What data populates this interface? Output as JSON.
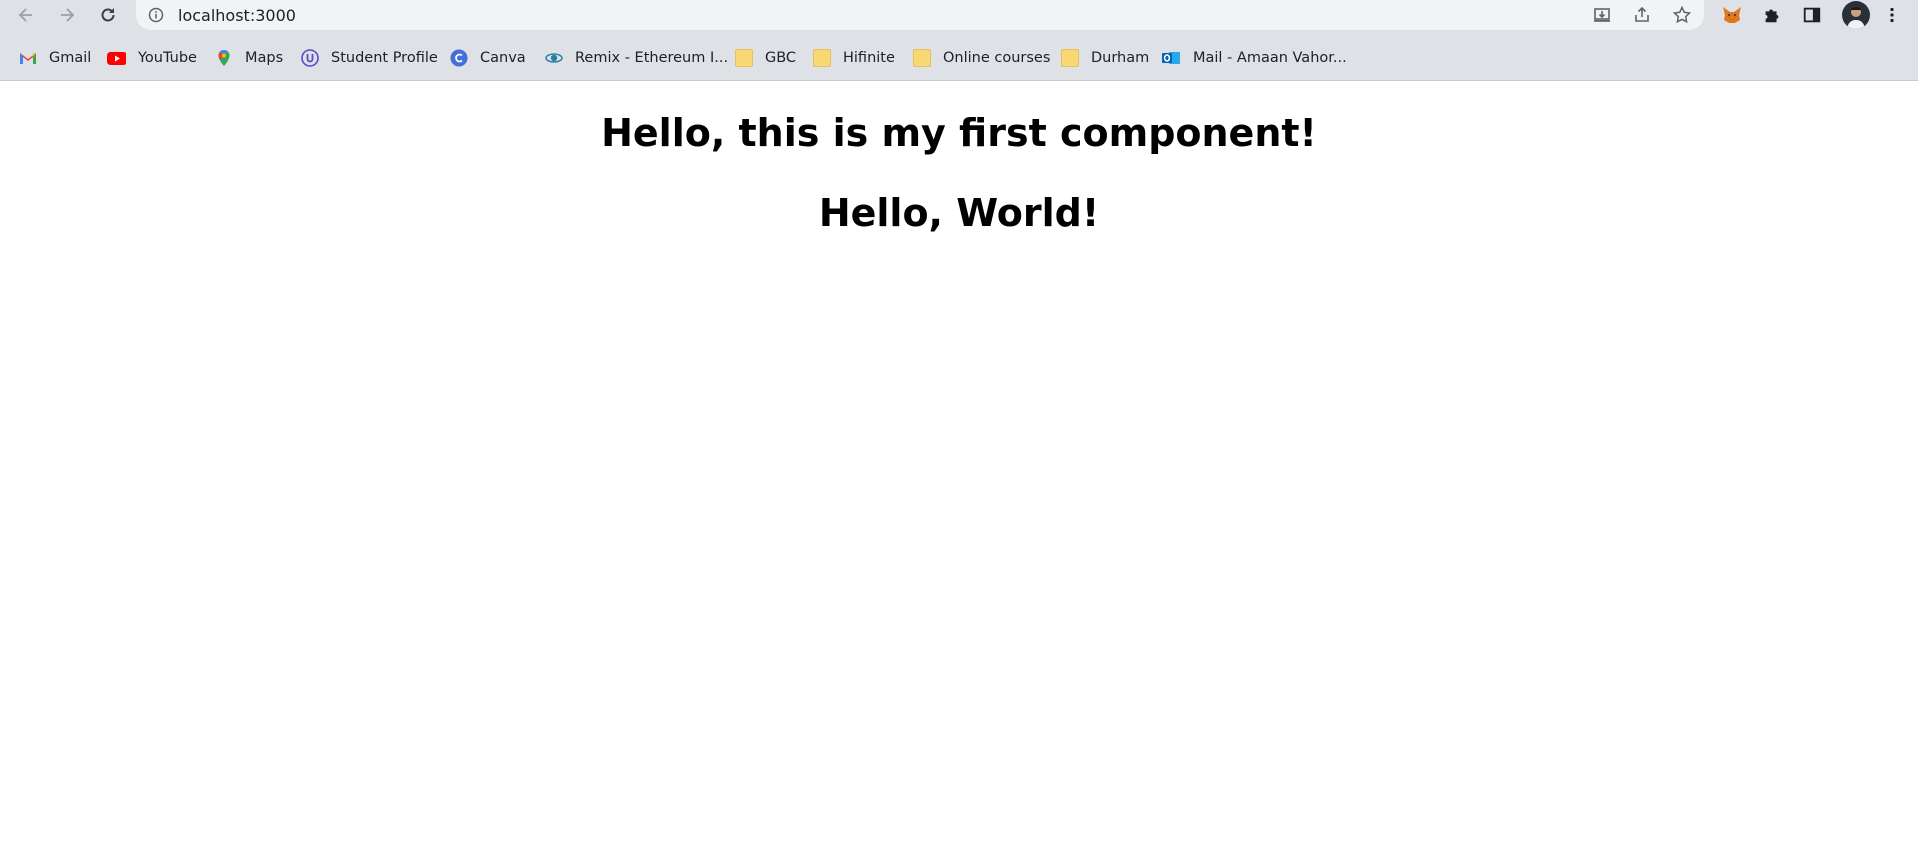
{
  "browser": {
    "url": "localhost:3000",
    "bookmarks": [
      {
        "label": "Gmail",
        "icon": "gmail-icon"
      },
      {
        "label": "YouTube",
        "icon": "youtube-icon"
      },
      {
        "label": "Maps",
        "icon": "maps-icon"
      },
      {
        "label": "Student Profile",
        "icon": "student-profile-icon"
      },
      {
        "label": "Canva",
        "icon": "canva-icon"
      },
      {
        "label": "Remix - Ethereum I...",
        "icon": "remix-icon"
      },
      {
        "label": "GBC",
        "icon": "folder-icon"
      },
      {
        "label": "Hifinite",
        "icon": "folder-icon"
      },
      {
        "label": "Online courses",
        "icon": "folder-icon"
      },
      {
        "label": "Durham",
        "icon": "folder-icon"
      },
      {
        "label": "Mail - Amaan Vahor...",
        "icon": "outlook-icon"
      }
    ]
  },
  "page": {
    "heading1": "Hello, this is my first component!",
    "heading2": "Hello, World!"
  }
}
